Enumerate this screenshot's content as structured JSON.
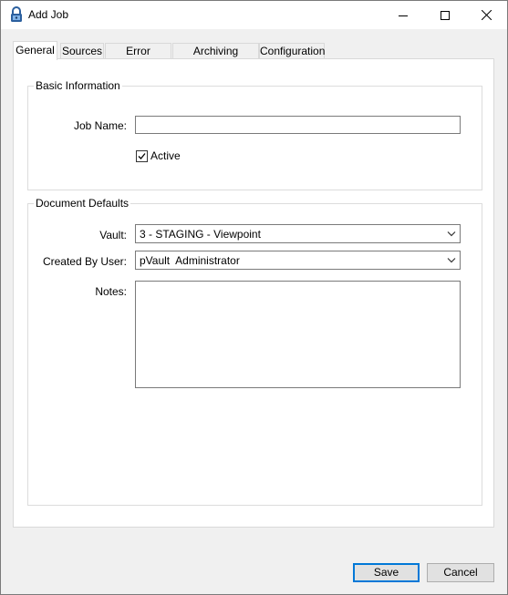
{
  "window": {
    "title": "Add Job",
    "controls": {
      "minimize": "minimize-icon",
      "maximize": "maximize-icon",
      "close": "close-icon"
    }
  },
  "tabs": [
    {
      "label": "General",
      "active": true
    },
    {
      "label": "Sources",
      "active": false
    },
    {
      "label": "Error Options",
      "active": false
    },
    {
      "label": "Archiving Options",
      "active": false
    },
    {
      "label": "Configuration",
      "active": false
    }
  ],
  "basic_info": {
    "title": "Basic Information",
    "job_name_label": "Job Name:",
    "job_name_value": "",
    "active_label": "Active",
    "active_checked": true
  },
  "doc_defaults": {
    "title": "Document Defaults",
    "vault_label": "Vault:",
    "vault_value": "3 - STAGING - Viewpoint",
    "created_by_label": "Created By User:",
    "created_by_value": "pVault  Administrator",
    "notes_label": "Notes:",
    "notes_value": ""
  },
  "buttons": {
    "save": "Save",
    "cancel": "Cancel"
  },
  "colors": {
    "accent": "#0078d7",
    "border": "#7a7a7a",
    "panel": "#ffffff",
    "background": "#f0f0f0"
  }
}
